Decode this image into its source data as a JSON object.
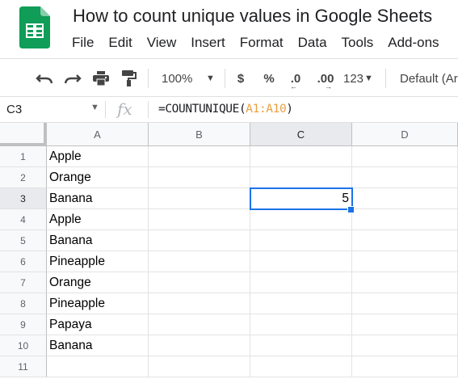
{
  "app": {
    "title": "How to count unique values in Google Sheets",
    "menu": [
      "File",
      "Edit",
      "View",
      "Insert",
      "Format",
      "Data",
      "Tools",
      "Add-ons"
    ]
  },
  "toolbar": {
    "zoom": "100%",
    "currency": "$",
    "percent": "%",
    "decrease_decimals": ".0",
    "increase_decimals": ".00",
    "more_formats": "123",
    "font": "Default (Ar"
  },
  "formula_bar": {
    "cell_ref": "C3",
    "fx_label": "fx",
    "formula_prefix": "=COUNTUNIQUE(",
    "formula_range": "A1:A10",
    "formula_suffix": ")"
  },
  "grid": {
    "columns": [
      "A",
      "B",
      "C",
      "D"
    ],
    "rows": [
      "1",
      "2",
      "3",
      "4",
      "5",
      "6",
      "7",
      "8",
      "9",
      "10",
      "11"
    ],
    "column_a": [
      "Apple",
      "Orange",
      "Banana",
      "Apple",
      "Banana",
      "Pineapple",
      "Orange",
      "Pineapple",
      "Papaya",
      "Banana",
      ""
    ],
    "c3_value": "5"
  },
  "colors": {
    "accent": "#1a73e8",
    "sheets_green": "#0f9d58",
    "range_ref": "#e8a040"
  }
}
